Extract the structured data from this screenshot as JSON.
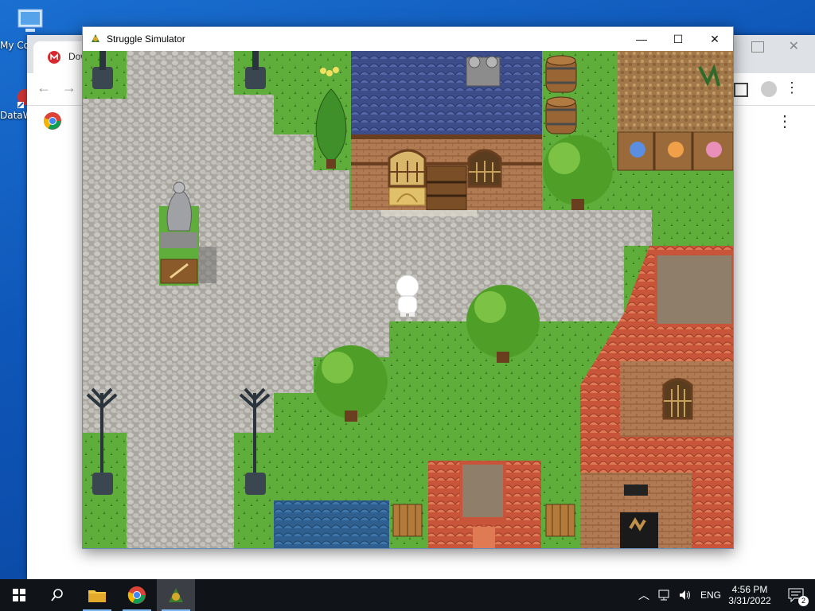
{
  "desktop": {
    "icons": [
      {
        "label": "My Co",
        "icon": "computer-icon"
      },
      {
        "label": "DataW",
        "icon": "shortcut-icon"
      }
    ]
  },
  "background_browser": {
    "tab_title": "Dow",
    "tab_icon": "mega-icon"
  },
  "window": {
    "title": "Struggle Simulator",
    "minimize": "—",
    "maximize": "☐",
    "close": "✕"
  },
  "scene": {
    "player": "white-character",
    "objects": [
      "house",
      "statue",
      "lamp-post",
      "tree",
      "barrel",
      "flower-planter",
      "cobblestone-path"
    ]
  },
  "taskbar": {
    "apps": [
      "start-icon",
      "search-icon",
      "file-explorer-icon",
      "chrome-icon",
      "game-icon"
    ],
    "language": "ENG",
    "time": "4:56 PM",
    "date": "3/31/2022",
    "notifications": "2"
  },
  "colors": {
    "grass": "#5fa938",
    "cobble": "#b9b7b1",
    "roof_blue": "#3d4f8a",
    "roof_red": "#d25c3d",
    "taskbar": "#101418"
  }
}
